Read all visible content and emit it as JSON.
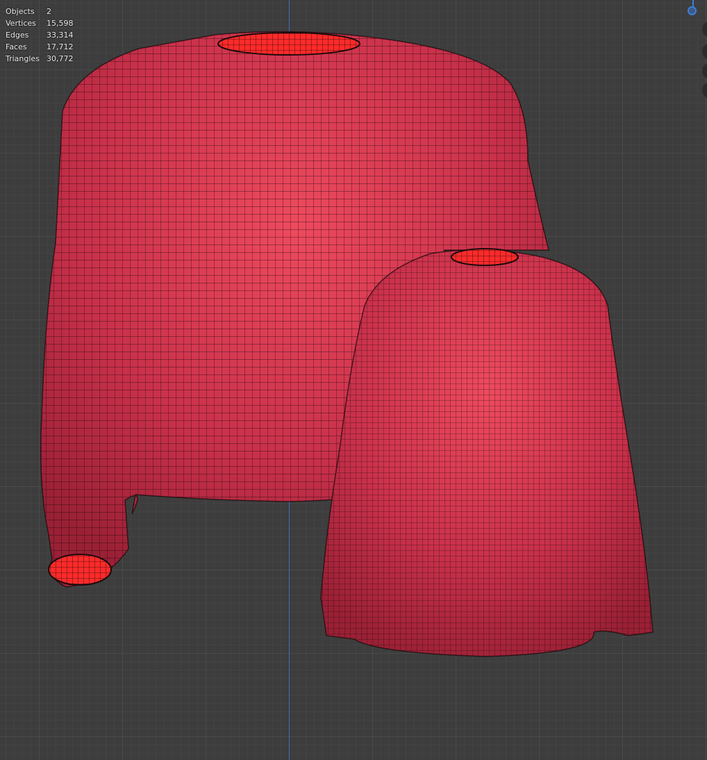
{
  "stats": [
    {
      "label": "Objects",
      "value": "2"
    },
    {
      "label": "Vertices",
      "value": "15,598"
    },
    {
      "label": "Edges",
      "value": "33,314"
    },
    {
      "label": "Faces",
      "value": "17,712"
    },
    {
      "label": "Triangles",
      "value": "30,772"
    }
  ],
  "colors": {
    "mesh": "#d8374f",
    "wire": "#1a0a0c",
    "collar": "#ff2a2a",
    "z_axis": "#3c7fd8",
    "background": "#3d3d3d"
  }
}
